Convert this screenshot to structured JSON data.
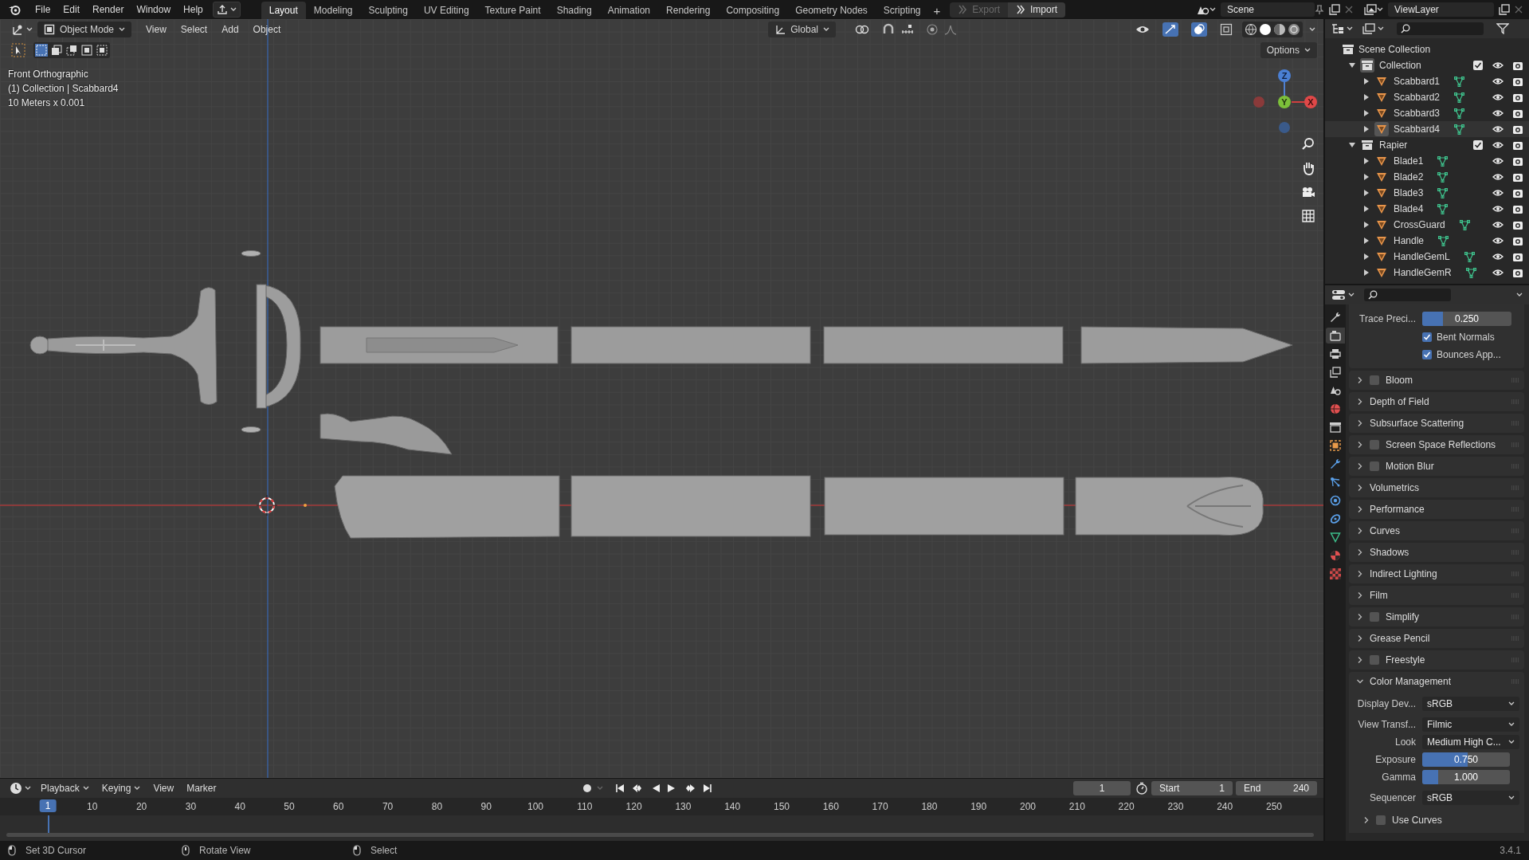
{
  "app_menu": [
    "File",
    "Edit",
    "Render",
    "Window",
    "Help"
  ],
  "workspaces": [
    {
      "label": "Layout",
      "selected": true
    },
    {
      "label": "Modeling",
      "selected": false
    },
    {
      "label": "Sculpting",
      "selected": false
    },
    {
      "label": "UV Editing",
      "selected": false
    },
    {
      "label": "Texture Paint",
      "selected": false
    },
    {
      "label": "Shading",
      "selected": false
    },
    {
      "label": "Animation",
      "selected": false
    },
    {
      "label": "Rendering",
      "selected": false
    },
    {
      "label": "Compositing",
      "selected": false
    },
    {
      "label": "Geometry Nodes",
      "selected": false
    },
    {
      "label": "Scripting",
      "selected": false
    }
  ],
  "add_workspace": "+",
  "asset_buttons": [
    {
      "label": "Export",
      "disabled": true
    },
    {
      "label": "Import",
      "disabled": false
    }
  ],
  "scene": "Scene",
  "view_layer": "ViewLayer",
  "viewport": {
    "mode": "Object Mode",
    "menus": [
      "View",
      "Select",
      "Add",
      "Object"
    ],
    "orientation": "Global",
    "options": "Options",
    "info": [
      "Front Orthographic",
      "(1) Collection | Scabbard4",
      "10 Meters x 0.001"
    ],
    "gizmo": {
      "x": "X",
      "y": "Y",
      "z": "Z"
    }
  },
  "outliner": {
    "root": "Scene Collection",
    "collections": [
      {
        "name": "Collection",
        "expanded": true,
        "checked": true,
        "children": [
          {
            "name": "Scabbard1",
            "selected": false,
            "expanded": false
          },
          {
            "name": "Scabbard2",
            "selected": false,
            "expanded": false
          },
          {
            "name": "Scabbard3",
            "selected": false,
            "expanded": false
          },
          {
            "name": "Scabbard4",
            "selected": true,
            "expanded": false
          }
        ]
      },
      {
        "name": "Rapier",
        "expanded": true,
        "checked": true,
        "children": [
          {
            "name": "Blade1",
            "selected": false,
            "expanded": false
          },
          {
            "name": "Blade2",
            "selected": false,
            "expanded": false
          },
          {
            "name": "Blade3",
            "selected": false,
            "expanded": false
          },
          {
            "name": "Blade4",
            "selected": false,
            "expanded": false
          },
          {
            "name": "CrossGuard",
            "selected": false,
            "expanded": false
          },
          {
            "name": "Handle",
            "selected": false,
            "expanded": false
          },
          {
            "name": "HandleGemL",
            "selected": false,
            "expanded": false
          },
          {
            "name": "HandleGemR",
            "selected": false,
            "expanded": false
          }
        ]
      }
    ]
  },
  "properties": {
    "tabs": [
      {
        "kind": "tool",
        "selected": false
      },
      {
        "kind": "render",
        "selected": true
      },
      {
        "kind": "output",
        "selected": false
      },
      {
        "kind": "view_layer",
        "selected": false
      },
      {
        "kind": "scene",
        "selected": false
      },
      {
        "kind": "world",
        "selected": false
      },
      {
        "kind": "collection",
        "selected": false
      },
      {
        "kind": "object",
        "selected": false
      },
      {
        "kind": "modifier",
        "selected": false
      },
      {
        "kind": "particles",
        "selected": false
      },
      {
        "kind": "physics",
        "selected": false
      },
      {
        "kind": "constraints",
        "selected": false
      },
      {
        "kind": "data",
        "selected": false
      },
      {
        "kind": "material",
        "selected": false
      },
      {
        "kind": "texture",
        "selected": false
      }
    ],
    "trace": {
      "label": "Trace Preci...",
      "value": "0.250",
      "level": 0.23
    },
    "options": [
      {
        "label": "Bent Normals",
        "checked": true
      },
      {
        "label": "Bounces App...",
        "checked": true
      }
    ],
    "panels": [
      {
        "label": "Bloom",
        "kind": "checkbox",
        "checked": false,
        "expanded": false
      },
      {
        "label": "Depth of Field",
        "kind": "plain",
        "expanded": false
      },
      {
        "label": "Subsurface Scattering",
        "kind": "plain",
        "expanded": false
      },
      {
        "label": "Screen Space Reflections",
        "kind": "checkbox",
        "checked": false,
        "expanded": false
      },
      {
        "label": "Motion Blur",
        "kind": "checkbox",
        "checked": false,
        "expanded": false
      },
      {
        "label": "Volumetrics",
        "kind": "plain",
        "expanded": false
      },
      {
        "label": "Performance",
        "kind": "plain",
        "expanded": false
      },
      {
        "label": "Curves",
        "kind": "plain",
        "expanded": false
      },
      {
        "label": "Shadows",
        "kind": "plain",
        "expanded": false
      },
      {
        "label": "Indirect Lighting",
        "kind": "plain",
        "expanded": false
      },
      {
        "label": "Film",
        "kind": "plain",
        "expanded": false
      },
      {
        "label": "Simplify",
        "kind": "checkbox",
        "checked": false,
        "expanded": false
      },
      {
        "label": "Grease Pencil",
        "kind": "plain",
        "expanded": false
      },
      {
        "label": "Freestyle",
        "kind": "checkbox",
        "checked": false,
        "expanded": false
      },
      {
        "label": "Color Management",
        "kind": "plain",
        "expanded": true,
        "fields": [
          {
            "kind": "select",
            "label": "Display Dev...",
            "value": "sRGB"
          },
          {
            "kind": "select",
            "label": "View Transf...",
            "value": "Filmic"
          },
          {
            "kind": "select",
            "label": "Look",
            "value": "Medium High C..."
          },
          {
            "kind": "slider",
            "label": "Exposure",
            "value": "0.750",
            "level": 0.52
          },
          {
            "kind": "slider",
            "label": "Gamma",
            "value": "1.000",
            "level": 0.18
          },
          {
            "kind": "select",
            "label": "Sequencer",
            "value": "sRGB"
          }
        ],
        "subpanel": {
          "label": "Use Curves",
          "checked": false,
          "expanded": false
        }
      }
    ]
  },
  "timeline": {
    "menus": [
      {
        "label": "Playback",
        "kind": "dropdown"
      },
      {
        "label": "Keying",
        "kind": "dropdown"
      },
      {
        "label": "View",
        "kind": "menu"
      },
      {
        "label": "Marker",
        "kind": "menu"
      }
    ],
    "frame": "1",
    "start_label": "Start",
    "start": "1",
    "end_label": "End",
    "end": "240",
    "current_frame": "1",
    "ruler": [
      "10",
      "20",
      "30",
      "40",
      "50",
      "60",
      "70",
      "80",
      "90",
      "100",
      "110",
      "120",
      "130",
      "140",
      "150",
      "160",
      "170",
      "180",
      "190",
      "200",
      "210",
      "220",
      "230",
      "240",
      "250"
    ]
  },
  "status_bar": {
    "hints": [
      {
        "kind": "left",
        "label": "Set 3D Cursor"
      },
      {
        "kind": "middle",
        "label": "Rotate View"
      },
      {
        "kind": "left",
        "label": "Select"
      }
    ],
    "version": "3.4.1"
  }
}
